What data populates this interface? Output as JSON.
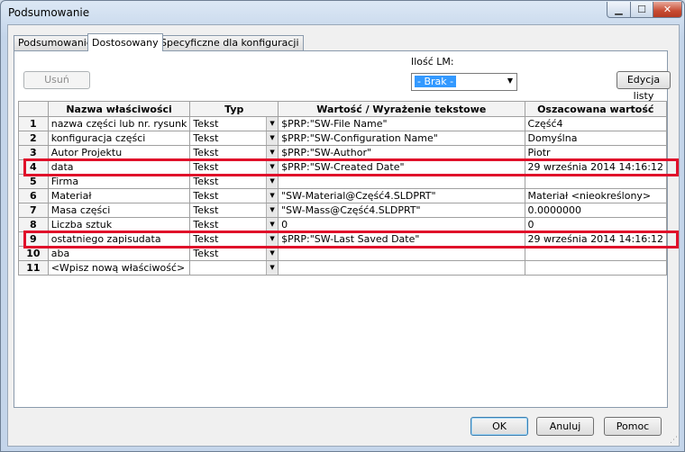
{
  "window": {
    "title": "Podsumowanie"
  },
  "tabs": [
    {
      "label": "Podsumowanie",
      "active": false
    },
    {
      "label": "Dostosowany",
      "active": true
    },
    {
      "label": "Specyficzne dla konfiguracji",
      "active": false
    }
  ],
  "toolbar": {
    "remove_label": "Usuń",
    "lm_label": "Ilość LM:",
    "lm_value": "- Brak -",
    "edit_list_label": "Edycja listy"
  },
  "table": {
    "headers": [
      "",
      "Nazwa właściwości",
      "Typ",
      "Wartość / Wyrażenie tekstowe",
      "Oszacowana wartość"
    ],
    "rows": [
      {
        "num": "1",
        "name": "nazwa części lub nr. rysunk",
        "type": "Tekst",
        "value": "$PRP:\"SW-File Name\"",
        "evaluated": "Część4"
      },
      {
        "num": "2",
        "name": "konfiguracja części",
        "type": "Tekst",
        "value": "$PRP:\"SW-Configuration Name\"",
        "evaluated": "Domyślna"
      },
      {
        "num": "3",
        "name": "Autor Projektu",
        "type": "Tekst",
        "value": "$PRP:\"SW-Author\"",
        "evaluated": "Piotr"
      },
      {
        "num": "4",
        "name": "data",
        "type": "Tekst",
        "value": "$PRP:\"SW-Created Date\"",
        "evaluated": "29 września 2014 14:16:12"
      },
      {
        "num": "5",
        "name": "Firma",
        "type": "Tekst",
        "value": "",
        "evaluated": ""
      },
      {
        "num": "6",
        "name": "Materiał",
        "type": "Tekst",
        "value": "\"SW-Material@Część4.SLDPRT\"",
        "evaluated": "Materiał <nieokreślony>"
      },
      {
        "num": "7",
        "name": "Masa części",
        "type": "Tekst",
        "value": "\"SW-Mass@Część4.SLDPRT\"",
        "evaluated": "0.0000000"
      },
      {
        "num": "8",
        "name": "Liczba sztuk",
        "type": "Tekst",
        "value": "0",
        "evaluated": "0"
      },
      {
        "num": "9",
        "name": "ostatniego zapisudata",
        "type": "Tekst",
        "value": "$PRP:\"SW-Last Saved Date\"",
        "evaluated": "29 września 2014 14:16:12"
      },
      {
        "num": "10",
        "name": "aba",
        "type": "Tekst",
        "value": "",
        "evaluated": ""
      },
      {
        "num": "11",
        "name": "<Wpisz nową właściwość>",
        "type": "",
        "value": "",
        "evaluated": ""
      }
    ],
    "highlighted_rows": [
      "4",
      "9"
    ],
    "highlight_color": "#e0102a"
  },
  "buttons": {
    "ok": "OK",
    "cancel": "Anuluj",
    "help": "Pomoc"
  }
}
